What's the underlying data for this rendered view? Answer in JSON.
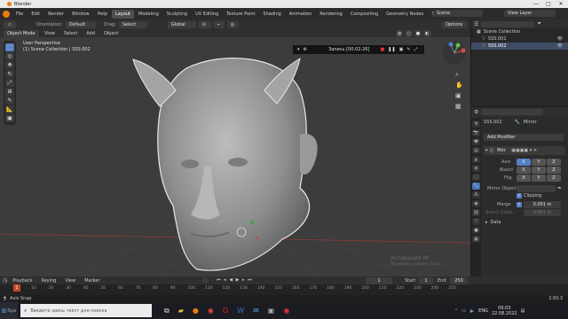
{
  "window": {
    "title": "Blender",
    "minimize": "—",
    "maximize": "□",
    "close": "✕"
  },
  "menu": [
    "File",
    "Edit",
    "Render",
    "Window",
    "Help"
  ],
  "workspaces": [
    "Layout",
    "Modeling",
    "Sculpting",
    "UV Editing",
    "Texture Paint",
    "Shading",
    "Animation",
    "Rendering",
    "Compositing",
    "Geometry Nodes",
    "Scripting"
  ],
  "scene": {
    "label": "Scene",
    "view_layer": "View Layer"
  },
  "toolbar": {
    "orientation_label": "Orientation:",
    "orientation_value": "Default",
    "drag_label": "Drag:",
    "drag_value": "Select Box",
    "transform_value": "Global",
    "options": "Options"
  },
  "header": {
    "mode": "Object Mode",
    "items": [
      "View",
      "Select",
      "Add",
      "Object"
    ]
  },
  "viewport": {
    "perspective": "User Perspective",
    "collection": "(1) Scene Collection | SSS.002",
    "watermark": "Активация Wi",
    "watermark2": "Перейдите в раздел \"Пара..."
  },
  "recording": {
    "text": "Запись [00:02:26]"
  },
  "outliner": {
    "root": "Scene Collection",
    "items": [
      "SSS.001",
      "SSS.002"
    ]
  },
  "properties": {
    "object_name": "SSS.002",
    "modifier_type": "Mirror",
    "add_modifier": "Add Modifier",
    "modifier_name": "Mirr",
    "axis_label": "Axis",
    "bisect_label": "Bisect",
    "flip_label": "Flip",
    "axes": [
      "X",
      "Y",
      "Z"
    ],
    "mirror_object_label": "Mirror Object",
    "clipping_label": "Clipping",
    "merge_label": "Merge",
    "merge_value": "0.001 m",
    "bisect_distance_label": "Bisect Dista...",
    "bisect_distance_value": "0.001 m",
    "data_label": "Data"
  },
  "timeline": {
    "menu": [
      "Playback",
      "Keying",
      "View",
      "Marker"
    ],
    "current_frame": "1",
    "start_label": "Start",
    "start_value": "1",
    "end_label": "End",
    "end_value": "250",
    "ticks": [
      "1",
      "10",
      "20",
      "30",
      "40",
      "50",
      "60",
      "70",
      "80",
      "90",
      "100",
      "110",
      "120",
      "130",
      "140",
      "150",
      "160",
      "170",
      "180",
      "190",
      "200",
      "210",
      "220",
      "230",
      "240",
      "250"
    ]
  },
  "status": {
    "left": "Axis Snap",
    "version": "2.93.3"
  },
  "taskbar": {
    "start": "Пуск",
    "search_placeholder": "Введите здесь текст для поиска",
    "lang": "ENG",
    "time": "09:03",
    "date": "22.08.2022"
  }
}
